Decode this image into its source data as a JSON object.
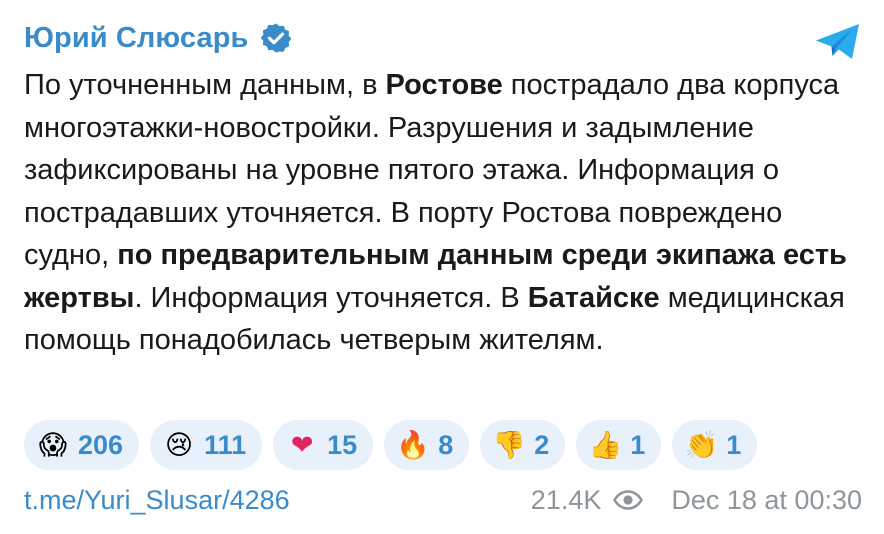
{
  "post": {
    "author": "Юрий Слюсарь",
    "author_verified": true,
    "text_segments": [
      {
        "text": "По уточненным данным, в ",
        "bold": false
      },
      {
        "text": "Ростове",
        "bold": true
      },
      {
        "text": " пострадало два корпуса многоэтажки-новостройки. Разрушения и задымление зафиксированы на уровне пятого этажа. Информация о пострадавших уточняется. В порту Ростова повреждено судно, ",
        "bold": false
      },
      {
        "text": "по предварительным данным среди экипажа есть жертвы",
        "bold": true
      },
      {
        "text": ". Информация уточняется. В ",
        "bold": false
      },
      {
        "text": "Батайске",
        "bold": true
      },
      {
        "text": " медицинская помощь понадобилась четверым жителям.",
        "bold": false
      }
    ],
    "reactions": [
      {
        "emoji": "😱",
        "icon": "screaming-face-icon",
        "count": "206"
      },
      {
        "emoji": "😢",
        "icon": "crying-face-icon",
        "count": "111"
      },
      {
        "emoji": "❤",
        "icon": "heart-icon",
        "count": "15"
      },
      {
        "emoji": "🔥",
        "icon": "fire-icon",
        "count": "8"
      },
      {
        "emoji": "👎",
        "icon": "thumbs-down-icon",
        "count": "2"
      },
      {
        "emoji": "👍",
        "icon": "thumbs-up-icon",
        "count": "1"
      },
      {
        "emoji": "👏",
        "icon": "clapping-hands-icon",
        "count": "1"
      }
    ],
    "link": "t.me/Yuri_Slusar/4286",
    "views": "21.4K",
    "date": "Dec 18 at 00:30"
  },
  "colors": {
    "accent": "#3a8bc9",
    "reaction_bg": "#e8f1fb",
    "meta_gray": "#8e959b",
    "text": "#1a1a1a",
    "telegram_blue": "#2AABEE"
  }
}
